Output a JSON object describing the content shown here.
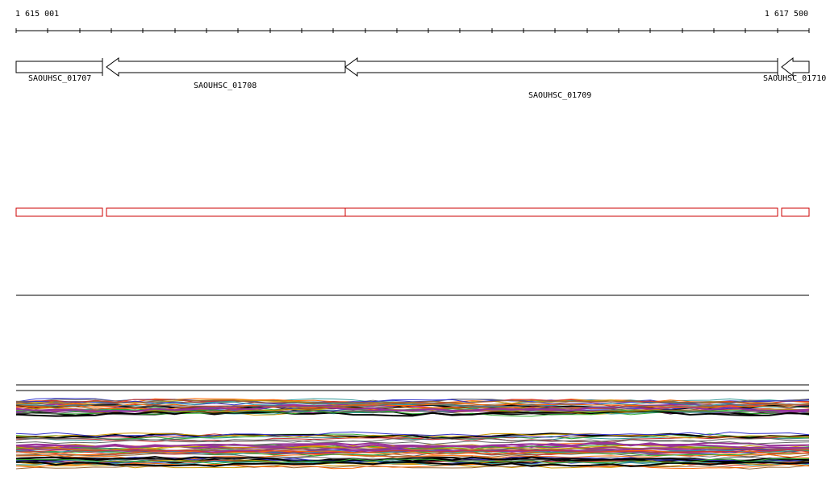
{
  "ruler": {
    "start_label": "1 615 001",
    "end_label": "1 617 500",
    "start": 1615001,
    "end": 1617500
  },
  "genes": [
    {
      "id": "SAOUHSC_01707",
      "strand": "+"
    },
    {
      "id": "SAOUHSC_01708",
      "strand": "-"
    },
    {
      "id": "SAOUHSC_01709",
      "strand": "-"
    },
    {
      "id": "SAOUHSC_01710",
      "strand": "-"
    }
  ],
  "colors": {
    "gene_outline": "#000000",
    "region_outline": "#cc0000",
    "track_line": "#000000",
    "read_palette": [
      "#000000",
      "#cc3333",
      "#33aa33",
      "#3333cc",
      "#cc9900",
      "#993399",
      "#339999",
      "#996633",
      "#ff6600",
      "#666666"
    ]
  }
}
